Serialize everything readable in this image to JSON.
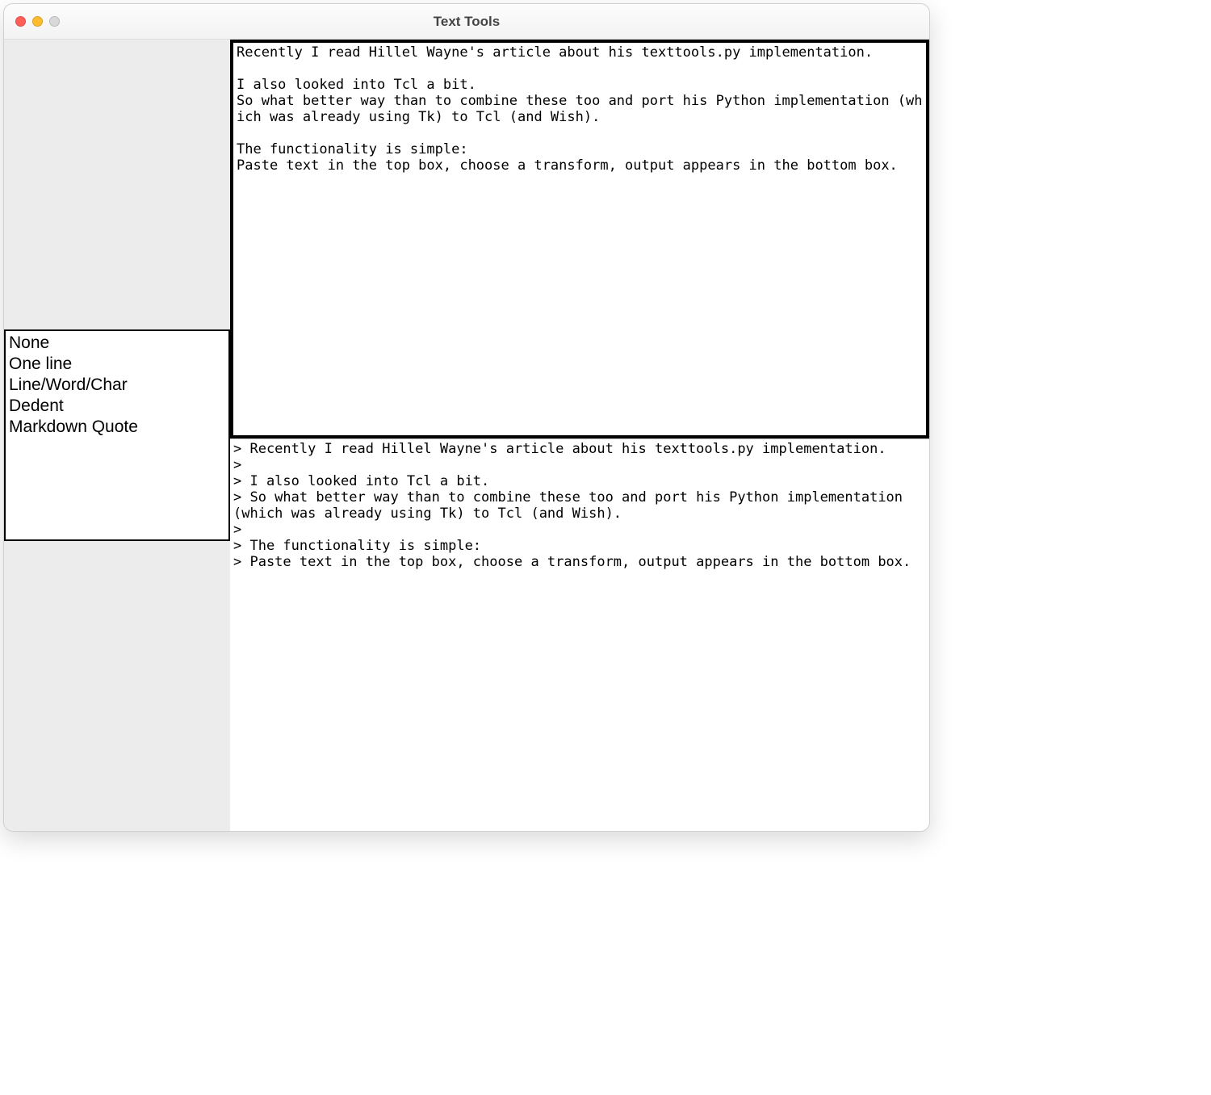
{
  "window": {
    "title": "Text Tools"
  },
  "sidebar": {
    "transforms": [
      "None",
      "One line",
      "Line/Word/Char",
      "Dedent",
      "Markdown Quote"
    ]
  },
  "input_text": "Recently I read Hillel Wayne's article about his texttools.py implementation.\n\nI also looked into Tcl a bit.\nSo what better way than to combine these too and port his Python implementation (which was already using Tk) to Tcl (and Wish).\n\nThe functionality is simple:\nPaste text in the top box, choose a transform, output appears in the bottom box.",
  "output_text": "> Recently I read Hillel Wayne's article about his texttools.py implementation.\n> \n> I also looked into Tcl a bit.\n> So what better way than to combine these too and port his Python implementation (which was already using Tk) to Tcl (and Wish).\n> \n> The functionality is simple:\n> Paste text in the top box, choose a transform, output appears in the bottom box."
}
